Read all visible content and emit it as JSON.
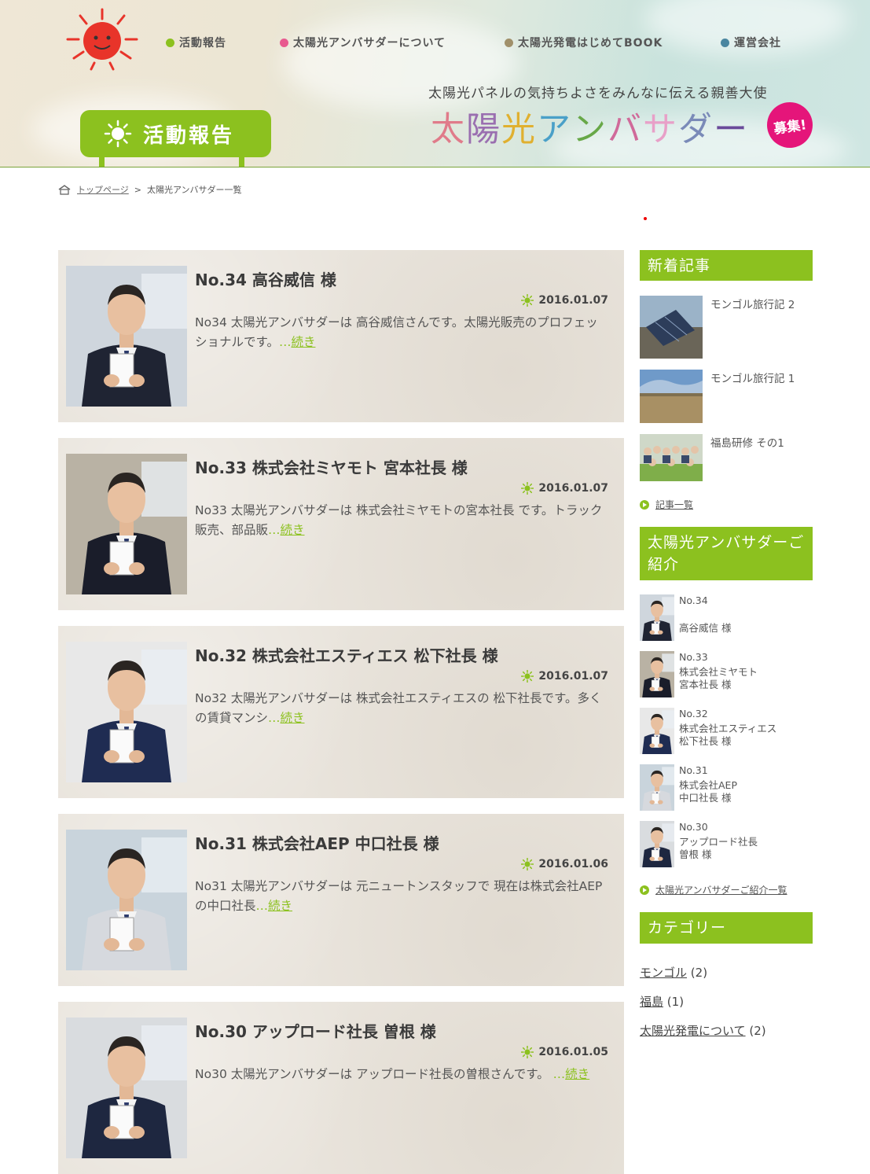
{
  "header": {
    "nav": [
      {
        "label": "活動報告",
        "color": "#8cc11f"
      },
      {
        "label": "太陽光アンバサダーについて",
        "color": "#e85a8f"
      },
      {
        "label": "太陽光発電はじめてBOOK",
        "color": "#a0906a"
      },
      {
        "label": "運営会社",
        "color": "#4a86a0"
      }
    ],
    "tagline": "太陽光パネルの気持ちよさをみんなに伝える親善大使",
    "brand": [
      "太",
      "陽",
      "光",
      "ア",
      "ン",
      "バ",
      "サ",
      "ダ",
      "ー"
    ],
    "brand_colors": [
      "#e07b8a",
      "#9a6fb0",
      "#e0b030",
      "#4aa0c8",
      "#68a848",
      "#d06a9a",
      "#e8a0c8",
      "#7a8ab8",
      "#6a4a9a"
    ],
    "recruit_badge": "募集!",
    "section_sign": "活動報告"
  },
  "breadcrumb": {
    "home": "トップページ",
    "separator": ">",
    "current": "太陽光アンバサダー一覧"
  },
  "posts": [
    {
      "title": "No.34 高谷威信 様",
      "date": "2016.01.07",
      "excerpt": "No34 太陽光アンバサダーは 高谷威信さんです。太陽光販売のプロフェッショナルです。",
      "ellipsis": "…",
      "more": "続き"
    },
    {
      "title": "No.33 株式会社ミヤモト 宮本社長 様",
      "date": "2016.01.07",
      "excerpt": "No33 太陽光アンバサダーは 株式会社ミヤモトの宮本社長 です。トラック販売、部品販",
      "ellipsis": "…",
      "more": "続き"
    },
    {
      "title": "No.32 株式会社エスティエス 松下社長 様",
      "date": "2016.01.07",
      "excerpt": "No32 太陽光アンバサダーは 株式会社エスティエスの 松下社長です。多くの賃貸マンシ",
      "ellipsis": "…",
      "more": "続き"
    },
    {
      "title": "No.31 株式会社AEP 中口社長 様",
      "date": "2016.01.06",
      "excerpt": "No31 太陽光アンバサダーは 元ニュートンスタッフで 現在は株式会社AEPの中口社長",
      "ellipsis": "…",
      "more": "続き"
    },
    {
      "title": "No.30 アップロード社長 曽根 様",
      "date": "2016.01.05",
      "excerpt": "No30 太陽光アンバサダーは アップロード社長の曽根さんです。",
      "ellipsis": " …",
      "more": "続き"
    }
  ],
  "sidebar": {
    "recent_heading": "新着記事",
    "recent": [
      {
        "label": "モンゴル旅行記 2"
      },
      {
        "label": "モンゴル旅行記 1"
      },
      {
        "label": "福島研修 その1"
      }
    ],
    "recent_more": "記事一覧",
    "ambassador_heading": "太陽光アンバサダーご紹介",
    "ambassadors": [
      {
        "no": "No.34",
        "line2": "",
        "line3": "高谷威信 様"
      },
      {
        "no": "No.33",
        "line2": "株式会社ミヤモト",
        "line3": "宮本社長 様"
      },
      {
        "no": "No.32",
        "line2": "株式会社エスティエス",
        "line3": "松下社長 様"
      },
      {
        "no": "No.31",
        "line2": "株式会社AEP",
        "line3": "中口社長 様"
      },
      {
        "no": "No.30",
        "line2": "アップロード社長",
        "line3": "曽根 様"
      }
    ],
    "ambassador_more": "太陽光アンバサダーご紹介一覧",
    "category_heading": "カテゴリー",
    "categories": [
      {
        "name": "モンゴル",
        "count": "(2)"
      },
      {
        "name": "福島",
        "count": "(1)"
      },
      {
        "name": "太陽光発電について",
        "count": "(2)"
      }
    ]
  }
}
